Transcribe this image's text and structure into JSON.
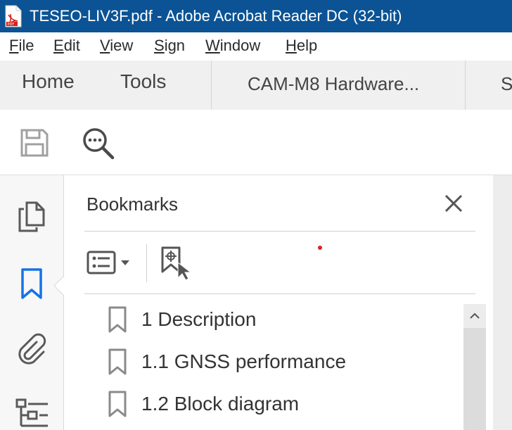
{
  "window": {
    "title": "TESEO-LIV3F.pdf - Adobe Acrobat Reader DC (32-bit)"
  },
  "menubar": {
    "items": [
      {
        "underline": "F",
        "rest": "ile"
      },
      {
        "underline": "E",
        "rest": "dit"
      },
      {
        "underline": "V",
        "rest": "iew"
      },
      {
        "underline": "S",
        "rest": "ign"
      },
      {
        "underline": "W",
        "rest": "indow"
      },
      {
        "underline": "H",
        "rest": "elp"
      }
    ]
  },
  "tabs": {
    "home": "Home",
    "tools": "Tools",
    "doc1": "CAM-M8 Hardware...",
    "doc2": "S"
  },
  "toolbar": {
    "icons": [
      "save-icon",
      "search-document-icon"
    ]
  },
  "leftrail": {
    "icons": [
      "page-thumbnails-icon",
      "bookmarks-icon",
      "attachments-icon",
      "structure-icon"
    ]
  },
  "bookmarks_panel": {
    "title": "Bookmarks",
    "items": [
      {
        "label": "1 Description"
      },
      {
        "label": "1.1 GNSS performance"
      },
      {
        "label": "1.2 Block diagram"
      }
    ]
  },
  "colors": {
    "titlebar": "#0b5394",
    "accent_blue": "#1473e6",
    "pdf_red": "#d4221f"
  }
}
